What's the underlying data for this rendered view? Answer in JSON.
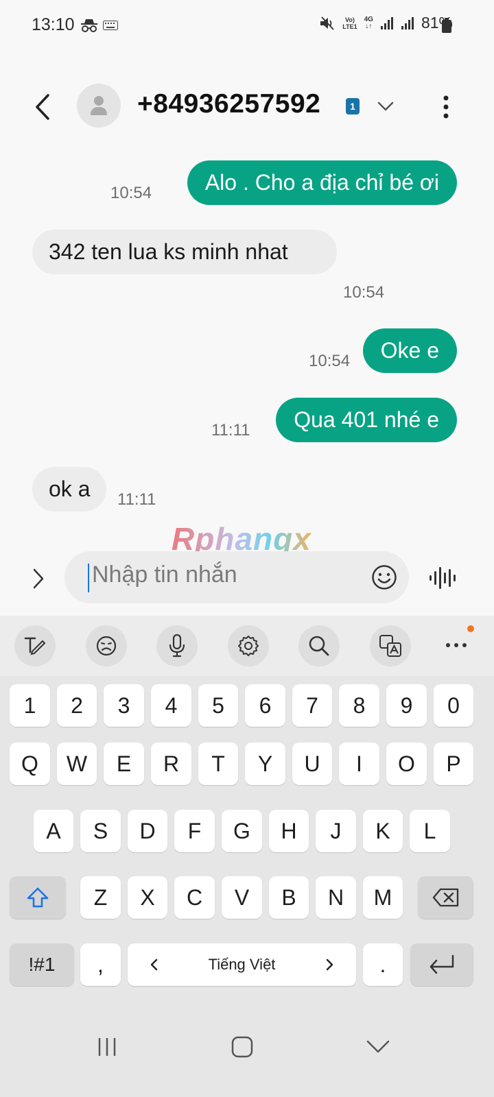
{
  "status_bar": {
    "time": "13:10",
    "volte": "Vo)",
    "lte": "LTE1",
    "network": "4G",
    "battery": "81%",
    "icons": [
      "incognito-icon",
      "keyboard-icon",
      "mute-icon",
      "signal-icon",
      "battery-icon"
    ]
  },
  "header": {
    "contact": "+84936257592",
    "sim_badge": "1",
    "icons": [
      "back-icon",
      "person-icon",
      "chevron-down-icon",
      "more-vert-icon"
    ]
  },
  "messages": [
    {
      "direction": "outgoing",
      "text": "Alo . Cho a địa chỉ bé ơi",
      "time": "10:54"
    },
    {
      "direction": "incoming",
      "text": "342 ten lua ks minh nhat",
      "time": "10:54"
    },
    {
      "direction": "outgoing",
      "text": "Oke e",
      "time": "10:54"
    },
    {
      "direction": "outgoing",
      "text": "Qua 401 nhé e",
      "time": "11:11"
    },
    {
      "direction": "incoming",
      "text": "ok a",
      "time": "11:11"
    }
  ],
  "watermark": "Rphangx",
  "compose": {
    "placeholder": "Nhập tin nhắn",
    "icons": [
      "chevron-right-icon",
      "emoji-icon",
      "voice-icon"
    ]
  },
  "keyboard": {
    "toolbar_icons": [
      "handwriting-icon",
      "emoji-icon",
      "mic-icon",
      "settings-icon",
      "search-icon",
      "translate-icon",
      "more-horiz-icon"
    ],
    "row_numbers": [
      "1",
      "2",
      "3",
      "4",
      "5",
      "6",
      "7",
      "8",
      "9",
      "0"
    ],
    "row_q": [
      "Q",
      "W",
      "E",
      "R",
      "T",
      "Y",
      "U",
      "I",
      "O",
      "P"
    ],
    "row_a": [
      "A",
      "S",
      "D",
      "F",
      "G",
      "H",
      "J",
      "K",
      "L"
    ],
    "row_z": [
      "Z",
      "X",
      "C",
      "V",
      "B",
      "N",
      "M"
    ],
    "symbols": "!#1",
    "comma": ",",
    "language": "Tiếng Việt",
    "period": ".",
    "special_icons": [
      "shift-icon",
      "backspace-icon",
      "enter-icon"
    ]
  },
  "nav_bar": {
    "icons": [
      "recents-icon",
      "home-icon",
      "back-down-icon"
    ]
  },
  "colors": {
    "outgoing_bubble": "#08a384",
    "incoming_bubble": "#ececec",
    "sim_badge": "#1a73a8",
    "notification_dot": "#f27322"
  }
}
